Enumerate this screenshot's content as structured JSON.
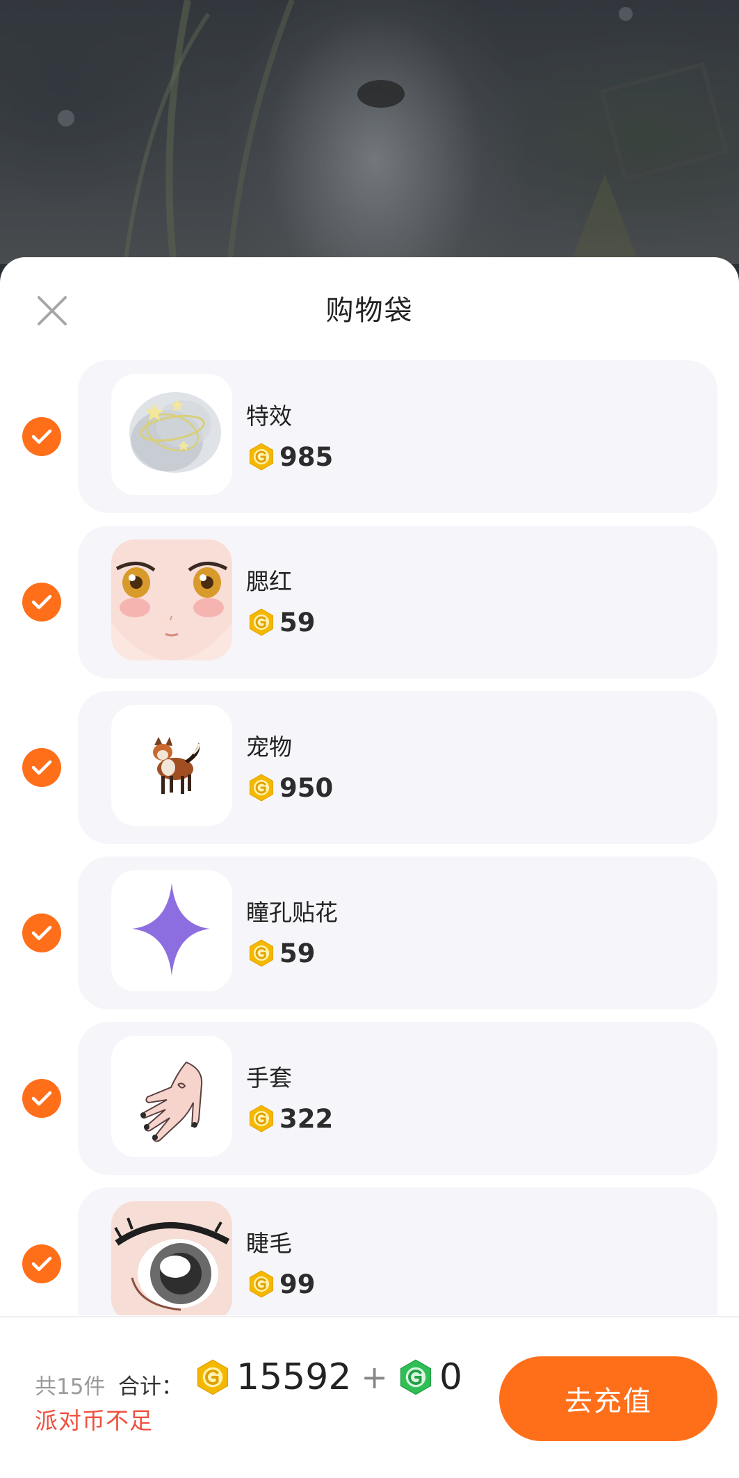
{
  "header": {
    "title": "购物袋",
    "close_icon": "close-icon"
  },
  "items": [
    {
      "name": "特效",
      "price": "985",
      "checked": true,
      "thumb_icon": "effect-halo-icon"
    },
    {
      "name": "腮红",
      "price": "59",
      "checked": true,
      "thumb_icon": "blush-face-icon"
    },
    {
      "name": "宠物",
      "price": "950",
      "checked": true,
      "thumb_icon": "pet-fox-icon"
    },
    {
      "name": "瞳孔贴花",
      "price": "59",
      "checked": true,
      "thumb_icon": "sparkle-star-icon"
    },
    {
      "name": "手套",
      "price": "322",
      "checked": true,
      "thumb_icon": "glove-hand-icon"
    },
    {
      "name": "睫毛",
      "price": "99",
      "checked": true,
      "thumb_icon": "eyelash-eye-icon"
    }
  ],
  "footer": {
    "count_text": "共15件",
    "total_label": "合计：",
    "gold_total": "15592",
    "plus": "+",
    "green_total": "0",
    "warning": "派对币不足",
    "recharge_label": "去充值"
  },
  "colors": {
    "accent": "#ff6f1a",
    "coin_gold": "#f5b800",
    "coin_green": "#2fbf55",
    "warning": "#f05040",
    "card_bg": "#f6f5f9"
  }
}
